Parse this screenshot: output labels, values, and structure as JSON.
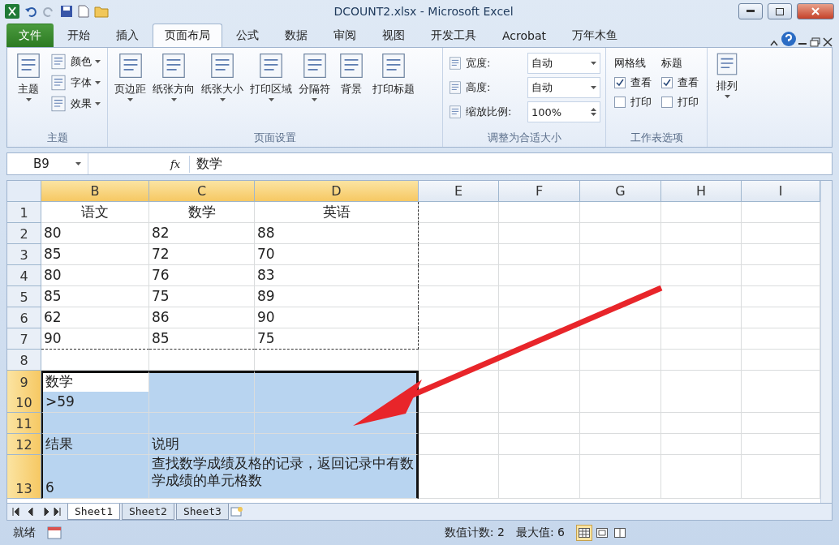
{
  "title_bar": {
    "title": "DCOUNT2.xlsx  -  Microsoft Excel"
  },
  "ribbon_tabs": [
    {
      "label": "文件",
      "kind": "file",
      "selected": false
    },
    {
      "label": "开始",
      "kind": "tab",
      "selected": false
    },
    {
      "label": "插入",
      "kind": "tab",
      "selected": false
    },
    {
      "label": "页面布局",
      "kind": "tab",
      "selected": true
    },
    {
      "label": "公式",
      "kind": "tab",
      "selected": false
    },
    {
      "label": "数据",
      "kind": "tab",
      "selected": false
    },
    {
      "label": "审阅",
      "kind": "tab",
      "selected": false
    },
    {
      "label": "视图",
      "kind": "tab",
      "selected": false
    },
    {
      "label": "开发工具",
      "kind": "tab",
      "selected": false
    },
    {
      "label": "Acrobat",
      "kind": "tab",
      "selected": false
    },
    {
      "label": "万年木鱼",
      "kind": "tab",
      "selected": false
    }
  ],
  "ribbon": {
    "theme_group": {
      "label": "主题",
      "big": "主题",
      "small": [
        "颜色",
        "字体",
        "效果"
      ]
    },
    "page_setup": {
      "label": "页面设置",
      "buttons": [
        {
          "label": "页边距",
          "dropdown": true
        },
        {
          "label": "纸张方向",
          "dropdown": true
        },
        {
          "label": "纸张大小",
          "dropdown": true
        },
        {
          "label": "打印区域",
          "dropdown": true
        },
        {
          "label": "分隔符",
          "dropdown": true
        },
        {
          "label": "背景",
          "dropdown": false
        },
        {
          "label": "打印标题",
          "dropdown": false
        }
      ]
    },
    "scale": {
      "label": "调整为合适大小",
      "fields": [
        {
          "label": "宽度:",
          "value": "自动",
          "kind": "dropdown"
        },
        {
          "label": "高度:",
          "value": "自动",
          "kind": "dropdown"
        },
        {
          "label": "缩放比例:",
          "value": "100%",
          "kind": "spinner"
        }
      ]
    },
    "sheet_options": {
      "label": "工作表选项",
      "columns": [
        {
          "title": "网格线",
          "options": [
            {
              "label": "查看",
              "checked": true
            },
            {
              "label": "打印",
              "checked": false
            }
          ]
        },
        {
          "title": "标题",
          "options": [
            {
              "label": "查看",
              "checked": true
            },
            {
              "label": "打印",
              "checked": false
            }
          ]
        }
      ]
    },
    "arrange": {
      "label": "排列"
    }
  },
  "formula_bar": {
    "name_box": "B9",
    "fx": "fx",
    "content": "数学"
  },
  "columns": [
    {
      "label": "B",
      "selected": true
    },
    {
      "label": "C",
      "selected": true
    },
    {
      "label": "D",
      "selected": true
    },
    {
      "label": "E",
      "selected": false
    },
    {
      "label": "F",
      "selected": false
    },
    {
      "label": "G",
      "selected": false
    },
    {
      "label": "H",
      "selected": false
    },
    {
      "label": "I",
      "selected": false
    }
  ],
  "rows": [
    {
      "header": "1",
      "kind": "heading",
      "selected": false,
      "print_area": true,
      "cells": [
        "语文",
        "数学",
        "英语"
      ]
    },
    {
      "header": "2",
      "kind": "data",
      "selected": false,
      "print_area": true,
      "cells": [
        "80",
        "82",
        "88"
      ]
    },
    {
      "header": "3",
      "kind": "data",
      "selected": false,
      "print_area": true,
      "cells": [
        "85",
        "72",
        "70"
      ]
    },
    {
      "header": "4",
      "kind": "data",
      "selected": false,
      "print_area": true,
      "cells": [
        "80",
        "76",
        "83"
      ]
    },
    {
      "header": "5",
      "kind": "data",
      "selected": false,
      "print_area": true,
      "cells": [
        "85",
        "75",
        "89"
      ]
    },
    {
      "header": "6",
      "kind": "data",
      "selected": false,
      "print_area": true,
      "cells": [
        "62",
        "86",
        "90"
      ]
    },
    {
      "header": "7",
      "kind": "data",
      "selected": false,
      "print_area": true,
      "cells": [
        "90",
        "85",
        "75"
      ]
    },
    {
      "header": "8",
      "kind": "data",
      "selected": false,
      "print_area": false,
      "cells": []
    },
    {
      "header": "9",
      "kind": "data",
      "selected": true,
      "print_area": false,
      "cells": [
        "数学"
      ]
    },
    {
      "header": "10",
      "kind": "data",
      "selected": true,
      "print_area": false,
      "cells": [
        ">59"
      ]
    },
    {
      "header": "11",
      "kind": "data",
      "selected": true,
      "print_area": false,
      "cells": []
    },
    {
      "header": "12",
      "kind": "data",
      "selected": true,
      "print_area": false,
      "cells": [
        "结果",
        "说明"
      ]
    },
    {
      "header": "13",
      "kind": "note",
      "selected": true,
      "print_area": false,
      "cells": [
        "6",
        "查找数学成绩及格的记录，返回记录中有数学成绩的单元格数"
      ]
    }
  ],
  "sheet_tabs": [
    {
      "label": "Sheet1",
      "selected": true
    },
    {
      "label": "Sheet2",
      "selected": false
    },
    {
      "label": "Sheet3",
      "selected": false
    }
  ],
  "status_bar": {
    "mode": "就绪",
    "items": [
      "数值计数: 2",
      "最大值: 6"
    ],
    "views": [
      {
        "selected": true
      },
      {
        "selected": false
      },
      {
        "selected": false
      }
    ]
  }
}
